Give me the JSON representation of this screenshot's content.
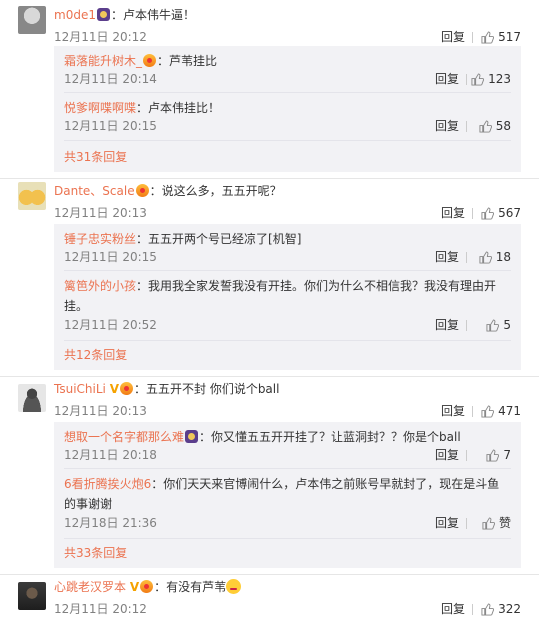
{
  "labels": {
    "reply": "回复"
  },
  "comments": [
    {
      "user": "m0de1",
      "text": "：卢本伟牛逼！",
      "time": "12月11日 20:12",
      "likes": "517",
      "replies": [
        {
          "user": "霜落能升树木_",
          "text": "：芦苇挂比",
          "time": "12月11日 20:14",
          "likes": "123"
        },
        {
          "user": "悦爹啊喋啊喋",
          "text": "：卢本伟挂比！",
          "time": "12月11日 20:15",
          "likes": "58"
        }
      ],
      "more": "共31条回复"
    },
    {
      "user": "Dante、Scale",
      "text": "：说这么多，五五开呢？",
      "time": "12月11日 20:13",
      "likes": "567",
      "replies": [
        {
          "user": "锤子忠实粉丝",
          "text": "：五五开两个号已经凉了[机智]",
          "time": "12月11日 20:15",
          "likes": "18"
        },
        {
          "user": "篱笆外的小孩",
          "text": "：我用我全家发誓我没有开挂。你们为什么不相信我？我没有理由开挂。",
          "time": "12月11日 20:52",
          "likes": "5"
        }
      ],
      "more": "共12条回复"
    },
    {
      "user": "TsuiChiLi",
      "text": "：五五开不封 你们说个ball",
      "time": "12月11日 20:13",
      "likes": "471",
      "replies": [
        {
          "user": "想取一个名字都那么难",
          "text": "：你又懂五五开开挂了？让蓝洞封？？你是个ball",
          "time": "12月11日 20:18",
          "likes": "7"
        },
        {
          "user": "6看折腾挨火炮6",
          "text": "：你们天天来官博闹什么，卢本伟之前账号早就封了，现在是斗鱼的事谢谢",
          "time": "12月18日 21:36",
          "likes": "赞"
        }
      ],
      "more": "共33条回复"
    },
    {
      "user": "心跳老汉罗本",
      "text": "：有没有芦苇",
      "time": "12月11日 20:12",
      "likes": "322",
      "replies": []
    }
  ]
}
